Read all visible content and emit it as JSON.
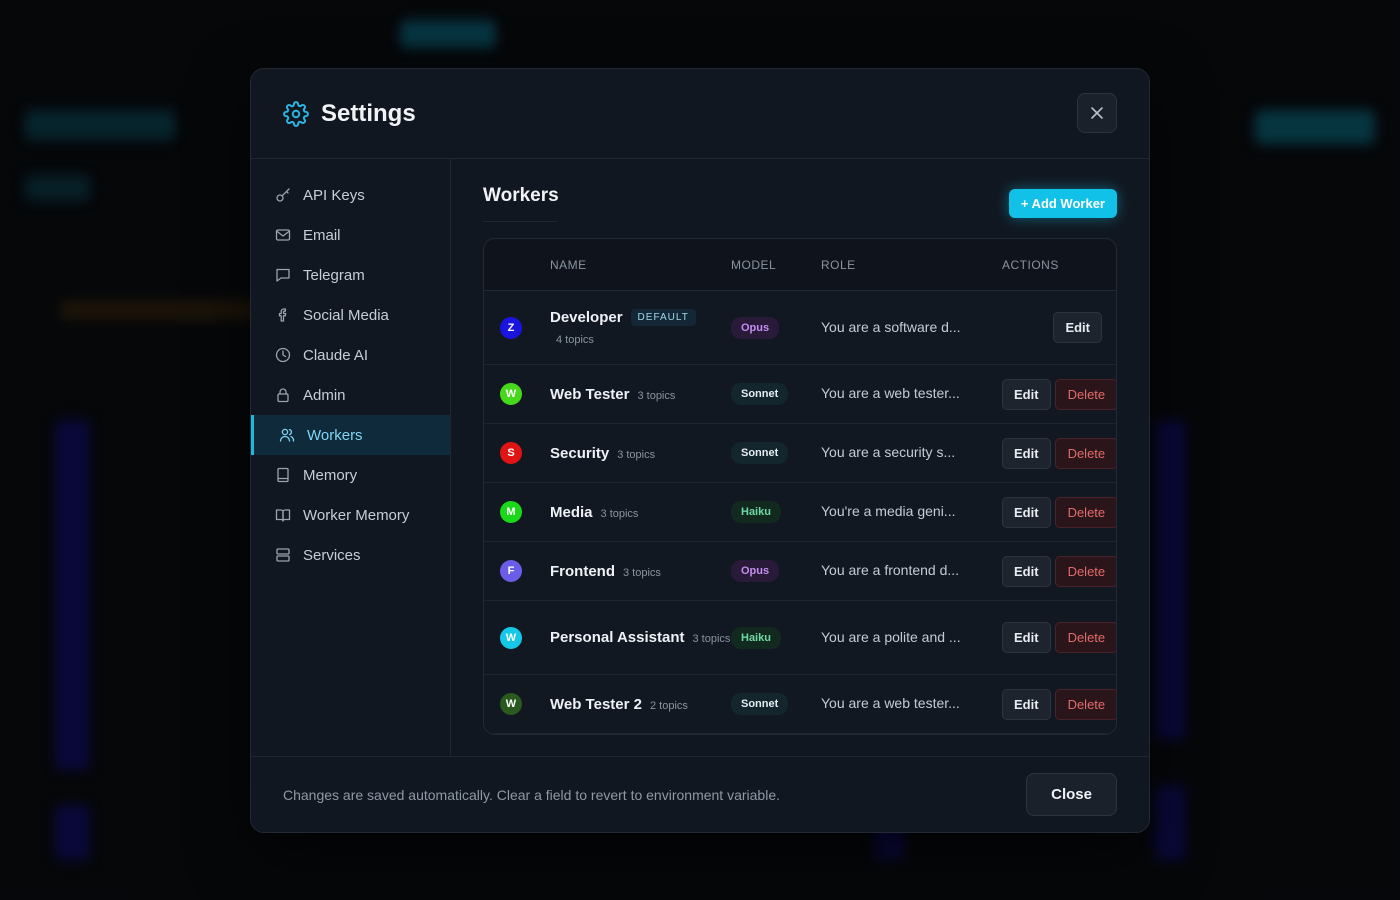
{
  "modal": {
    "title": "Settings",
    "icon": "gear-icon"
  },
  "sidebar": {
    "items": [
      {
        "label": "API Keys",
        "icon": "key-icon",
        "active": false
      },
      {
        "label": "Email",
        "icon": "mail-icon",
        "active": false
      },
      {
        "label": "Telegram",
        "icon": "chat-icon",
        "active": false
      },
      {
        "label": "Social Media",
        "icon": "facebook-icon",
        "active": false
      },
      {
        "label": "Claude AI",
        "icon": "clock-icon",
        "active": false
      },
      {
        "label": "Admin",
        "icon": "lock-icon",
        "active": false
      },
      {
        "label": "Workers",
        "icon": "users-icon",
        "active": true
      },
      {
        "label": "Memory",
        "icon": "notebook-icon",
        "active": false
      },
      {
        "label": "Worker Memory",
        "icon": "book-icon",
        "active": false
      },
      {
        "label": "Services",
        "icon": "server-icon",
        "active": false
      }
    ]
  },
  "workers": {
    "title": "Workers",
    "add_button": "+ Add Worker",
    "columns": {
      "name": "NAME",
      "model": "MODEL",
      "role": "ROLE",
      "actions": "ACTIONS"
    },
    "edit_label": "Edit",
    "delete_label": "Delete",
    "default_badge": "DEFAULT",
    "rows": [
      {
        "initial": "Z",
        "color": "#1a14e0",
        "name": "Developer",
        "topics": "4 topics",
        "model": "Opus",
        "role": "You are a software d...",
        "is_default": true
      },
      {
        "initial": "W",
        "color": "#46d81a",
        "name": "Web Tester",
        "topics": "3 topics",
        "model": "Sonnet",
        "role": "You are a web tester...",
        "is_default": false
      },
      {
        "initial": "S",
        "color": "#e01414",
        "name": "Security",
        "topics": "3 topics",
        "model": "Sonnet",
        "role": "You are a security s...",
        "is_default": false
      },
      {
        "initial": "M",
        "color": "#1ad81a",
        "name": "Media",
        "topics": "3 topics",
        "model": "Haiku",
        "role": "You're a media geni...",
        "is_default": false
      },
      {
        "initial": "F",
        "color": "#6a5ee8",
        "name": "Frontend",
        "topics": "3 topics",
        "model": "Opus",
        "role": "You are a frontend d...",
        "is_default": false
      },
      {
        "initial": "W",
        "color": "#14c8e8",
        "name": "Personal Assistant",
        "topics": "3 topics",
        "model": "Haiku",
        "role": "You are a polite and ...",
        "is_default": false
      },
      {
        "initial": "W",
        "color": "#2a5a1e",
        "name": "Web Tester 2",
        "topics": "2 topics",
        "model": "Sonnet",
        "role": "You are a web tester...",
        "is_default": false
      }
    ]
  },
  "model_colors": {
    "Opus": {
      "bg": "#2a1a3a",
      "fg": "#c58ef0"
    },
    "Sonnet": {
      "bg": "#13262e",
      "fg": "#e6eef2"
    },
    "Haiku": {
      "bg": "#12291f",
      "fg": "#6fd7a4"
    }
  },
  "footer": {
    "note": "Changes are saved automatically. Clear a field to revert to environment variable.",
    "close_label": "Close"
  }
}
